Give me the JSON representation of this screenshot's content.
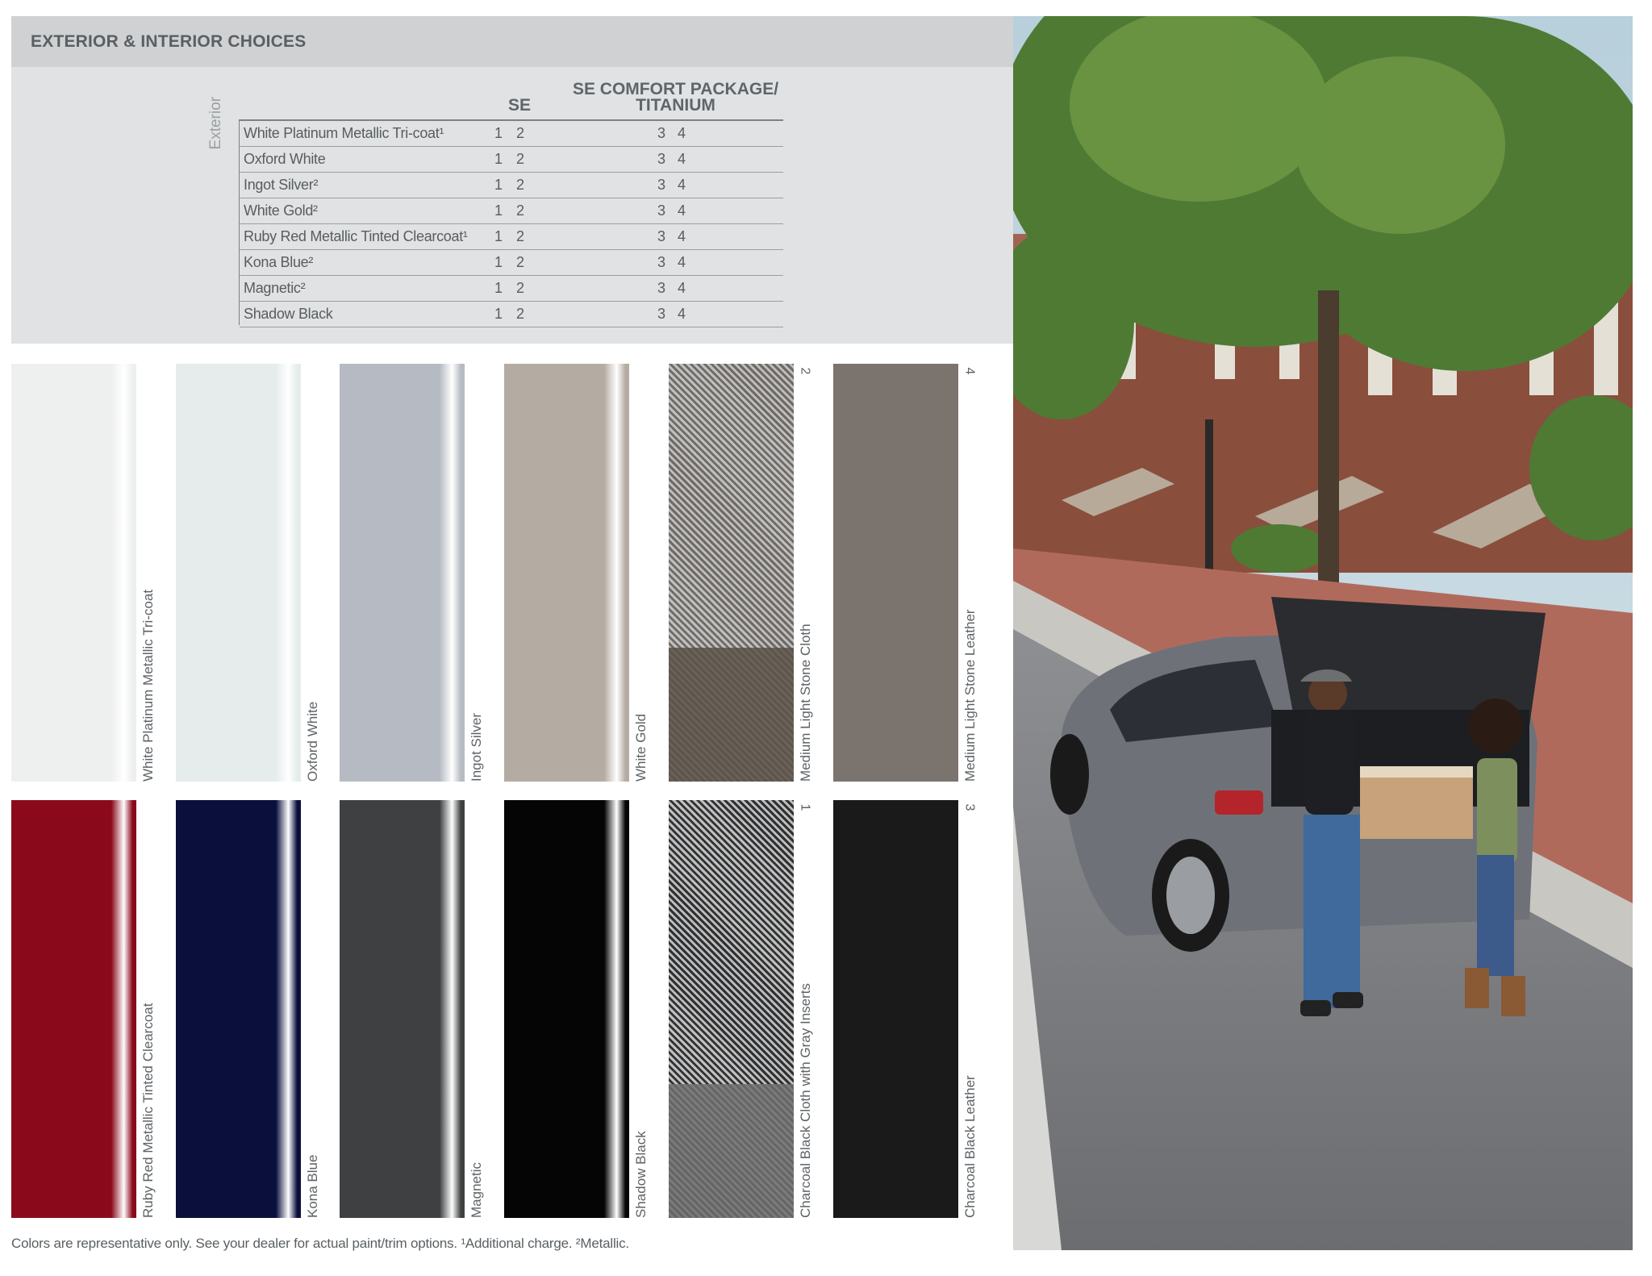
{
  "header": {
    "title": "EXTERIOR & INTERIOR CHOICES"
  },
  "table": {
    "side_label": "Exterior",
    "col_se": "SE",
    "col_comfort_line1": "SE COMFORT PACKAGE/",
    "col_comfort_line2": "TITANIUM",
    "rows": [
      {
        "name": "White Platinum Metallic Tri-coat¹",
        "se1": "1",
        "se2": "2",
        "t1": "3",
        "t2": "4"
      },
      {
        "name": "Oxford White",
        "se1": "1",
        "se2": "2",
        "t1": "3",
        "t2": "4"
      },
      {
        "name": "Ingot Silver²",
        "se1": "1",
        "se2": "2",
        "t1": "3",
        "t2": "4"
      },
      {
        "name": "White Gold²",
        "se1": "1",
        "se2": "2",
        "t1": "3",
        "t2": "4"
      },
      {
        "name": "Ruby Red Metallic Tinted Clearcoat¹",
        "se1": "1",
        "se2": "2",
        "t1": "3",
        "t2": "4"
      },
      {
        "name": "Kona Blue²",
        "se1": "1",
        "se2": "2",
        "t1": "3",
        "t2": "4"
      },
      {
        "name": "Magnetic²",
        "se1": "1",
        "se2": "2",
        "t1": "3",
        "t2": "4"
      },
      {
        "name": "Shadow Black",
        "se1": "1",
        "se2": "2",
        "t1": "3",
        "t2": "4"
      }
    ]
  },
  "swatches_top": [
    {
      "label": "White Platinum Metallic Tri-coat",
      "color": "#eef0ef",
      "number": ""
    },
    {
      "label": "Oxford White",
      "color": "#e6ecec",
      "number": ""
    },
    {
      "label": "Ingot Silver",
      "color": "#b6bbc3",
      "number": ""
    },
    {
      "label": "White Gold",
      "color": "#b4aca2",
      "number": ""
    },
    {
      "label": "Medium Light Stone Cloth",
      "color": "#6f6a65",
      "number": "2"
    },
    {
      "label": "Medium Light Stone Leather",
      "color": "#7b746e",
      "number": "4"
    }
  ],
  "swatches_bottom": [
    {
      "label": "Ruby Red Metallic Tinted Clearcoat",
      "color": "#8a0a1c",
      "number": ""
    },
    {
      "label": "Kona Blue",
      "color": "#0a0f3c",
      "number": ""
    },
    {
      "label": "Magnetic",
      "color": "#3f4042",
      "number": ""
    },
    {
      "label": "Shadow Black",
      "color": "#050505",
      "number": ""
    },
    {
      "label": "Charcoal Black Cloth with Gray Inserts",
      "color": "#303133",
      "number": "1"
    },
    {
      "label": "Charcoal Black Leather",
      "color": "#1a1a1a",
      "number": "3"
    }
  ],
  "footnote": "Colors are representative only. See your dealer for actual paint/trim options. ¹Additional charge. ²Metallic."
}
